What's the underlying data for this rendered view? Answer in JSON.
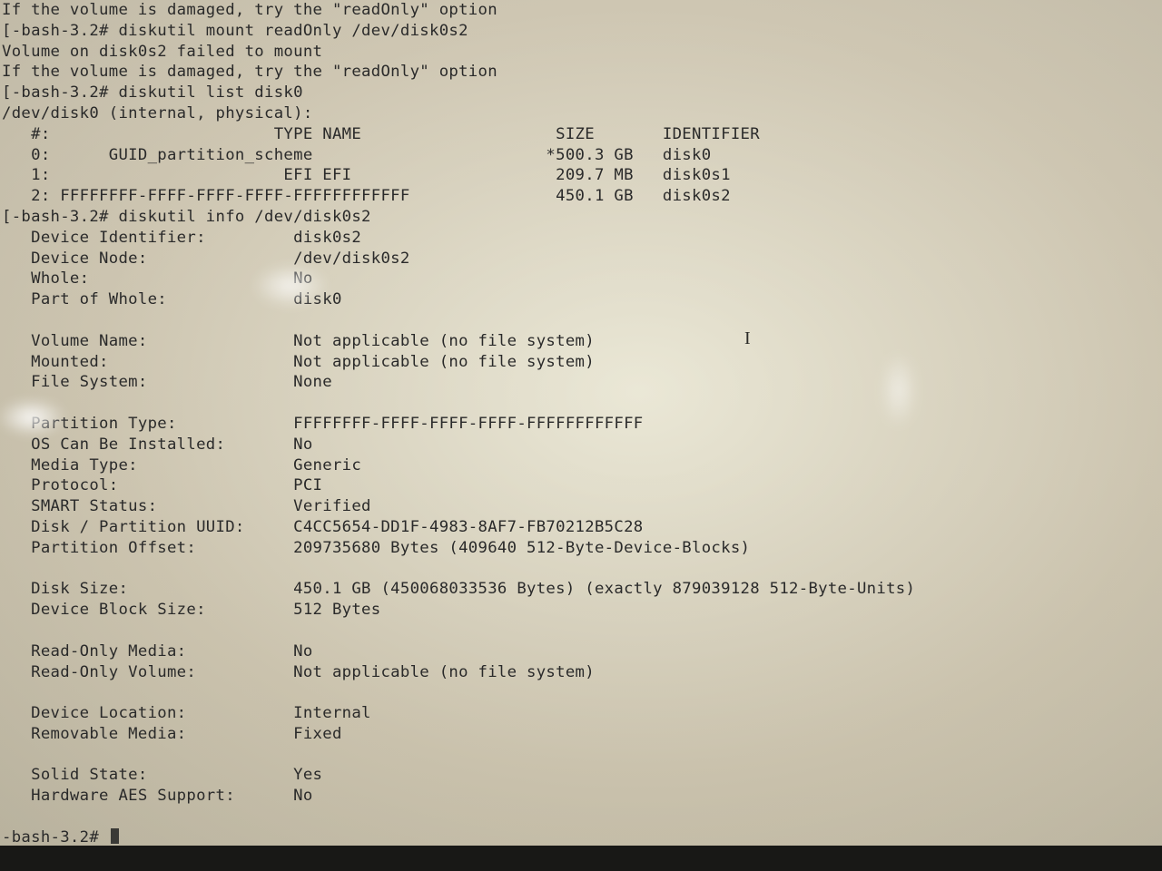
{
  "lines": {
    "l00": "If the volume is damaged, try the \"readOnly\" option",
    "l01": "[-bash-3.2# diskutil mount readOnly /dev/disk0s2",
    "l02": "Volume on disk0s2 failed to mount",
    "l03": "If the volume is damaged, try the \"readOnly\" option",
    "l04": "[-bash-3.2# diskutil list disk0",
    "l05": "/dev/disk0 (internal, physical):",
    "l06": "   #:                       TYPE NAME                    SIZE       IDENTIFIER",
    "l07": "   0:      GUID_partition_scheme                        *500.3 GB   disk0",
    "l08": "   1:                        EFI EFI                     209.7 MB   disk0s1",
    "l09": "   2: FFFFFFFF-FFFF-FFFF-FFFF-FFFFFFFFFFFF               450.1 GB   disk0s2",
    "l10": "[-bash-3.2# diskutil info /dev/disk0s2",
    "l11": "   Device Identifier:         disk0s2",
    "l12": "   Device Node:               /dev/disk0s2",
    "l13": "   Whole:                     No",
    "l14": "   Part of Whole:             disk0",
    "l15": "",
    "l16": "   Volume Name:               Not applicable (no file system)",
    "l17": "   Mounted:                   Not applicable (no file system)",
    "l18": "   File System:               None",
    "l19": "",
    "l20": "   Partition Type:            FFFFFFFF-FFFF-FFFF-FFFF-FFFFFFFFFFFF",
    "l21": "   OS Can Be Installed:       No",
    "l22": "   Media Type:                Generic",
    "l23": "   Protocol:                  PCI",
    "l24": "   SMART Status:              Verified",
    "l25": "   Disk / Partition UUID:     C4CC5654-DD1F-4983-8AF7-FB70212B5C28",
    "l26": "   Partition Offset:          209735680 Bytes (409640 512-Byte-Device-Blocks)",
    "l27": "",
    "l28": "   Disk Size:                 450.1 GB (450068033536 Bytes) (exactly 879039128 512-Byte-Units)",
    "l29": "   Device Block Size:         512 Bytes",
    "l30": "",
    "l31": "   Read-Only Media:           No",
    "l32": "   Read-Only Volume:          Not applicable (no file system)",
    "l33": "",
    "l34": "   Device Location:           Internal",
    "l35": "   Removable Media:           Fixed",
    "l36": "",
    "l37": "   Solid State:               Yes",
    "l38": "   Hardware AES Support:      No",
    "l39": "",
    "prompt": "-bash-3.2# "
  }
}
